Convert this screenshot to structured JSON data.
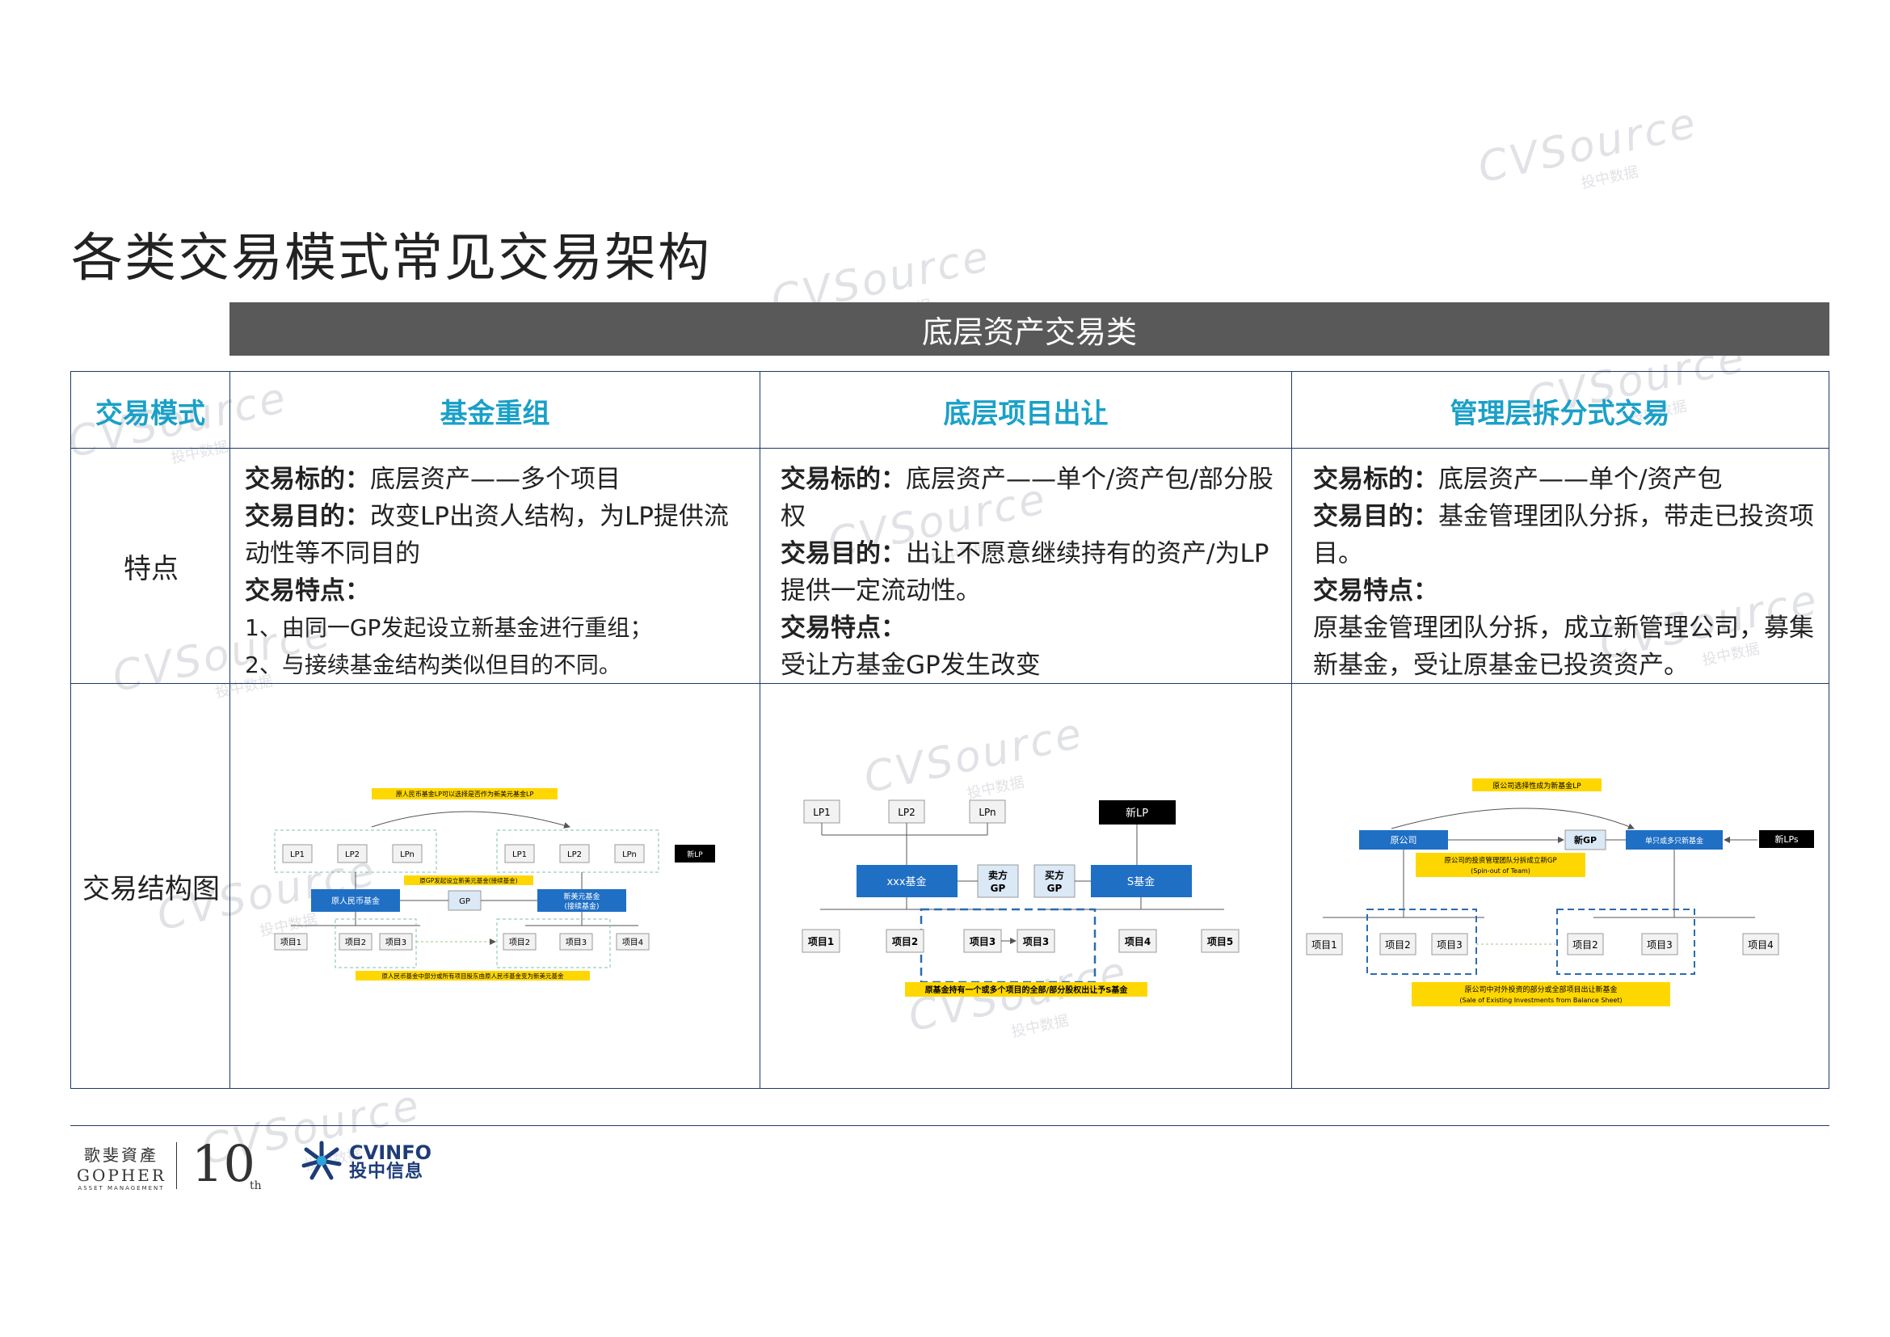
{
  "page_title": "各类交易模式常见交易架构",
  "band_title": "底层资产交易类",
  "table": {
    "header_col": "交易模式",
    "columns": [
      "基金重组",
      "底层项目出让",
      "管理层拆分式交易"
    ],
    "row_features": "特点",
    "row_diagram": "交易结构图"
  },
  "features": {
    "c1": {
      "l1_b": "交易标的：",
      "l1": "底层资产——多个项目",
      "l2_b": "交易目的：",
      "l2": "改变LP出资人结构，为LP提供流动性等不同目的",
      "l3_b": "交易特点：",
      "l4": "1、由同一GP发起设立新基金进行重组；",
      "l5": "2、与接续基金结构类似但目的不同。"
    },
    "c2": {
      "l1_b": "交易标的：",
      "l1": "底层资产——单个/资产包/部分股权",
      "l2_b": "交易目的：",
      "l2": "出让不愿意继续持有的资产/为LP提供一定流动性。",
      "l3_b": "交易特点：",
      "l4": "受让方基金GP发生改变"
    },
    "c3": {
      "l1_b": "交易标的：",
      "l1": "底层资产——单个/资产包",
      "l2_b": "交易目的：",
      "l2": "基金管理团队分拆，带走已投资项目。",
      "l3_b": "交易特点：",
      "l4": "原基金管理团队分拆，成立新管理公司，募集新基金，受让原基金已投资资产。"
    }
  },
  "diagram1": {
    "top_note": "原人民币基金LP可以选择是否作为新美元基金LP",
    "lp1": "LP1",
    "lp2": "LP2",
    "lpn": "LPn",
    "new_lp": "新LP",
    "mid_note": "原GP发起设立新美元基金(接续基金)",
    "fund_old": "原人民币基金",
    "gp": "GP",
    "fund_new_1": "新美元基金",
    "fund_new_2": "(接续基金)",
    "p1": "项目1",
    "p2": "项目2",
    "p3": "项目3",
    "p4": "项目4",
    "bottom_note": "原人民币基金中部分或所有项目股东由原人民币基金变为新美元基金"
  },
  "diagram2": {
    "lp1": "LP1",
    "lp2": "LP2",
    "lpn": "LPn",
    "new_lp": "新LP",
    "fund_a": "xxx基金",
    "seller_1": "卖方",
    "seller_2": "GP",
    "buyer_1": "买方",
    "buyer_2": "GP",
    "fund_s": "S基金",
    "p1": "项目1",
    "p2": "项目2",
    "p3": "项目3",
    "p4": "项目4",
    "p5": "项目5",
    "bottom_note": "原基金持有一个或多个项目的全部/部分股权出让予S基金"
  },
  "diagram3": {
    "top_note": "原公司选择性成为新基金LP",
    "company": "原公司",
    "new_gp": "新GP",
    "new_fund": "单只或多只新基金",
    "new_lps": "新LPs",
    "spin_1": "原公司的投资管理团队分拆成立新GP",
    "spin_2": "(Spin-out of Team)",
    "p1": "项目1",
    "p2": "项目2",
    "p3": "项目3",
    "p4": "项目4",
    "bottom_1": "原公司中对外投资的部分或全部项目出让新基金",
    "bottom_2": "(Sale of Existing Investments from Balance Sheet)"
  },
  "footer": {
    "gopher_cn": "歌斐資產",
    "gopher_en": "GOPHER",
    "gopher_sub": "ASSET MANAGEMENT",
    "ten": "10",
    "ten_sup": "th",
    "cv_en": "CVINFO",
    "cv_cn": "投中信息"
  },
  "watermark": {
    "brand": "CVSource",
    "cn": "投中数据"
  },
  "colors": {
    "blue_box": "#1f6fc5",
    "yellow": "#ffd700",
    "header_text": "#1aa0c8",
    "band": "#595959"
  }
}
